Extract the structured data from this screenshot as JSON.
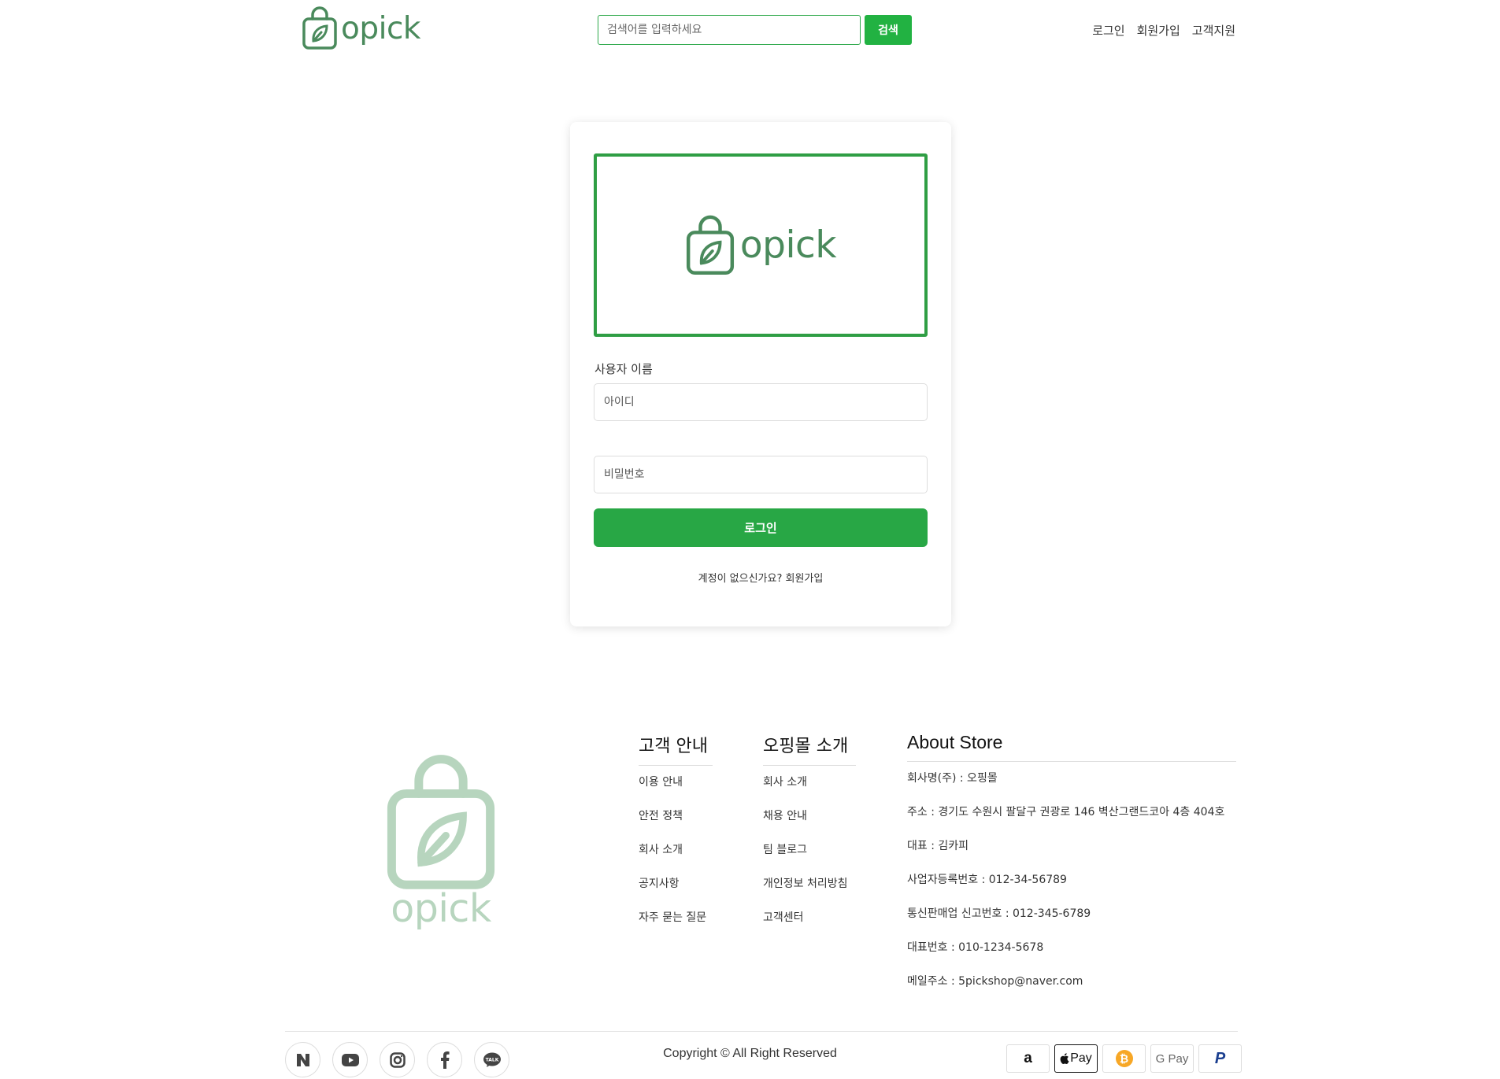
{
  "header": {
    "brand": "opick",
    "search": {
      "placeholder": "검색어를 입력하세요",
      "button": "검색"
    },
    "nav": [
      "로그인",
      "회원가입",
      "고객지원"
    ]
  },
  "login": {
    "logo_text": "opick",
    "username_label": "사용자 이름",
    "id_placeholder": "아이디",
    "password_placeholder": "비밀번호",
    "login_button": "로그인",
    "signup_prompt": "계정이 없으신가요? 회원가입"
  },
  "footer": {
    "logo_text": "opick",
    "customer_guide": {
      "title": "고객 안내",
      "items": [
        "이용 안내",
        "안전 정책",
        "회사 소개",
        "공지사항",
        "자주 묻는 질문"
      ]
    },
    "opick_intro": {
      "title": "오핑몰 소개",
      "items": [
        "회사 소개",
        "채용 안내",
        "팀 블로그",
        "개인정보 처리방침",
        "고객센터"
      ]
    },
    "about_store": {
      "title": "About Store",
      "items": [
        "회사명(주) : 오핑몰",
        "주소 : 경기도 수원시 팔달구 권광로 146 벽산그랜드코아 4층 404호",
        "대표 : 김카피",
        "사업자등록번호 : 012-34-56789",
        "통신판매업 신고번호 : 012-345-6789",
        "대표번호 : 010-1234-5678",
        "메일주소 : 5pickshop@naver.com"
      ]
    },
    "social_icons": [
      "naver-icon",
      "youtube-icon",
      "instagram-icon",
      "facebook-icon",
      "kakaotalk-icon"
    ],
    "copyright": "Copyright © All Right Reserved",
    "payment_icons": [
      "amazon-icon",
      "apple-pay-icon",
      "bitcoin-icon",
      "google-pay-icon",
      "paypal-icon"
    ],
    "payment_labels": {
      "amazon": "a",
      "apple": "Pay",
      "bitcoin": "₿",
      "google": "G Pay",
      "paypal": "P"
    }
  },
  "colors": {
    "brand": "#4a8a5c",
    "accent": "#28a745",
    "footer_logo": "#b7d5be"
  }
}
